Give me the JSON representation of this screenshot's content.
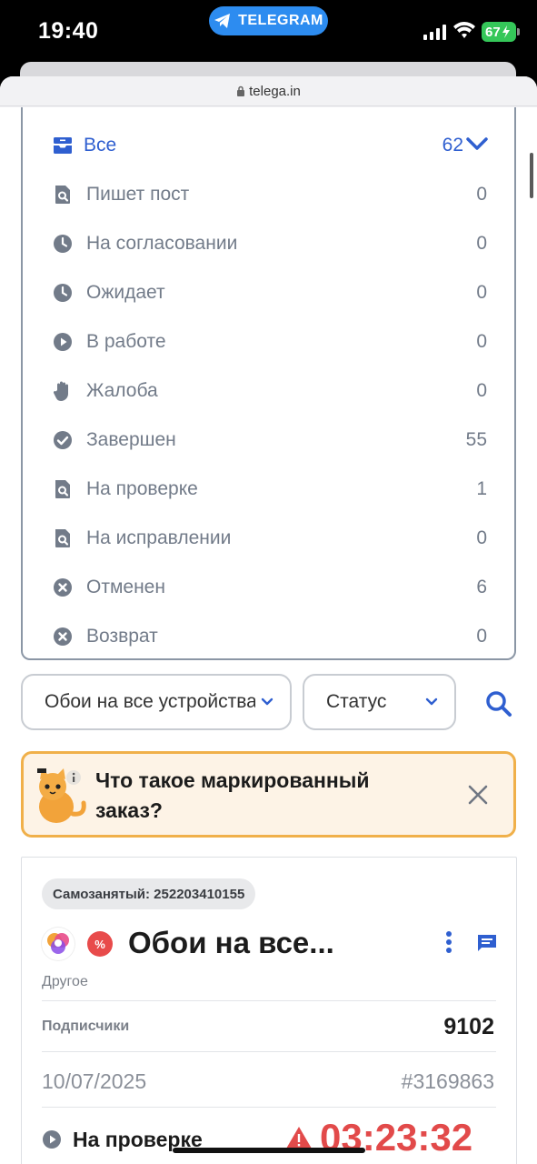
{
  "status_bar": {
    "time": "19:40",
    "app_pill": "TELEGRAM",
    "battery": "67"
  },
  "browser": {
    "url": "telega.in"
  },
  "status_list": [
    {
      "label": "Все",
      "count": "62",
      "icon": "inbox-icon",
      "active": true
    },
    {
      "label": "Пишет пост",
      "count": "0",
      "icon": "doc-search-icon"
    },
    {
      "label": "На согласовании",
      "count": "0",
      "icon": "clock-icon"
    },
    {
      "label": "Ожидает",
      "count": "0",
      "icon": "clock-icon"
    },
    {
      "label": "В работе",
      "count": "0",
      "icon": "play-icon"
    },
    {
      "label": "Жалоба",
      "count": "0",
      "icon": "hand-icon"
    },
    {
      "label": "Завершен",
      "count": "55",
      "icon": "check-circle-icon"
    },
    {
      "label": "На проверке",
      "count": "1",
      "icon": "doc-search-icon"
    },
    {
      "label": "На исправлении",
      "count": "0",
      "icon": "doc-search-icon"
    },
    {
      "label": "Отменен",
      "count": "6",
      "icon": "x-circle-icon"
    },
    {
      "label": "Возврат",
      "count": "0",
      "icon": "x-circle-icon"
    }
  ],
  "filters": {
    "channel_select": "Обои на все устройства",
    "status_select": "Статус"
  },
  "banner": {
    "text": "Что такое маркированный заказ?"
  },
  "order": {
    "tag": "Самозанятый: 252203410155",
    "title": "Обои на все...",
    "category": "Другое",
    "subscribers_label": "Подписчики",
    "subscribers_value": "9102",
    "date": "10/07/2025",
    "order_id": "#3169863",
    "status": "На проверке",
    "timer": "03:23:32"
  },
  "colors": {
    "accent": "#2f5fd0",
    "muted": "#727b89",
    "warning": "#f0b04a",
    "danger": "#e24a4a"
  }
}
